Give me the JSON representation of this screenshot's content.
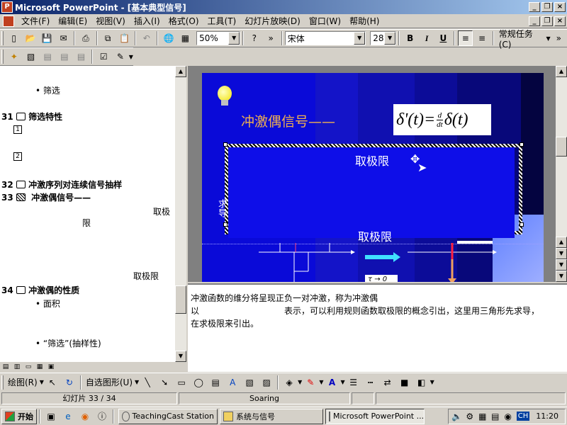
{
  "window": {
    "title": "Microsoft PowerPoint - [基本典型信号]"
  },
  "menu": [
    "文件(F)",
    "编辑(E)",
    "视图(V)",
    "插入(I)",
    "格式(O)",
    "工具(T)",
    "幻灯片放映(D)",
    "窗口(W)",
    "帮助(H)"
  ],
  "toolbar": {
    "zoom": "50%",
    "font": "宋体",
    "font_size": "28",
    "bold": "B",
    "italic": "I",
    "underline": "U",
    "tasks": "常规任务(C)"
  },
  "outline": {
    "items": [
      {
        "text": "• 筛选"
      },
      {
        "num": "31",
        "text": "筛选特性"
      },
      {
        "box": "1"
      },
      {
        "box": "2"
      },
      {
        "num": "32",
        "text": "冲激序列对连续信号抽样"
      },
      {
        "num": "33",
        "text": "冲激偶信号——"
      },
      {
        "text": "取极"
      },
      {
        "text": "限"
      },
      {
        "text": "取极限"
      },
      {
        "num": "34",
        "text": "冲激偶的性质"
      },
      {
        "text": "• 面积"
      },
      {
        "text": "• “筛选”(抽样性)"
      }
    ]
  },
  "slide": {
    "title": "冲激偶信号——",
    "formula_lhs": "δ'(t)=",
    "formula_d": "d",
    "formula_dt": "dt",
    "formula_rhs": "δ(t)",
    "label1": "取极限",
    "label2": "取极限",
    "side_label": "求导",
    "tau_label": "τ → 0"
  },
  "notes": {
    "line1": "冲激函数的维分将呈现正负一对冲激，称为冲激偶",
    "line2a": "以",
    "line2b": "表示，可以利用规则函数取极限的概念引出，这里用三角形先求导，",
    "line3": "在求极限来引出。"
  },
  "drawbar": {
    "draw": "绘图(R)",
    "autoshapes": "自选图形(U)"
  },
  "status": {
    "slide": "幻灯片 33 / 34",
    "design": "Soaring"
  },
  "taskbar": {
    "start": "开始",
    "tasks": [
      "TeachingCast Station",
      "系统与信号",
      "Microsoft PowerPoint ..."
    ],
    "lang": "CH",
    "clock": "11:20"
  }
}
